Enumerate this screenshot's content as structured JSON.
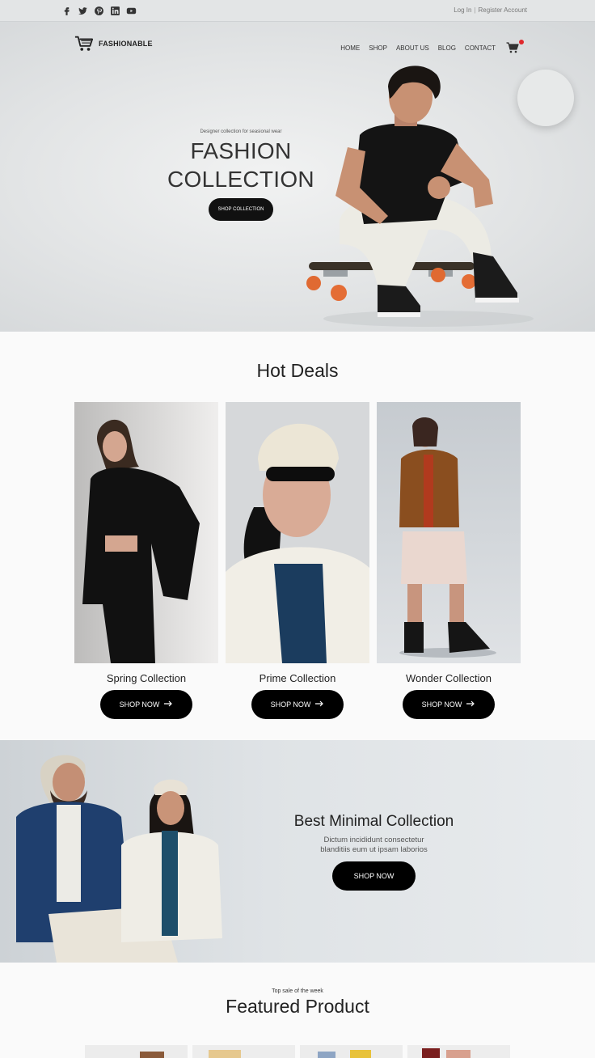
{
  "topbar": {
    "social_icons": [
      "facebook-icon",
      "twitter-icon",
      "pinterest-icon",
      "linkedin-icon",
      "youtube-icon"
    ],
    "login": "Log In",
    "register": "Register Account"
  },
  "header": {
    "brand": "FASHIONABLE",
    "nav": [
      "HOME",
      "SHOP",
      "ABOUT US",
      "BLOG",
      "CONTACT"
    ]
  },
  "hero": {
    "subtitle": "Designer collection for seasional wear",
    "title_line1": "FASHION",
    "title_line2": "COLLECTION",
    "button": "SHOP COLLECTION"
  },
  "hot_deals": {
    "title": "Hot Deals",
    "items": [
      {
        "name": "Spring Collection",
        "button": "SHOP NOW"
      },
      {
        "name": "Prime Collection",
        "button": "SHOP NOW"
      },
      {
        "name": "Wonder Collection",
        "button": "SHOP NOW"
      }
    ]
  },
  "banner": {
    "title": "Best Minimal Collection",
    "desc_line1": "Dictum incididunt consectetur",
    "desc_line2": "blanditiis eum ut ipsam laborios",
    "button": "SHOP NOW"
  },
  "featured": {
    "subtitle": "Top sale of the week",
    "title": "Featured Product"
  },
  "colors": {
    "accent": "#000000",
    "cart_badge": "#e0282c",
    "background": "#fafafa"
  }
}
